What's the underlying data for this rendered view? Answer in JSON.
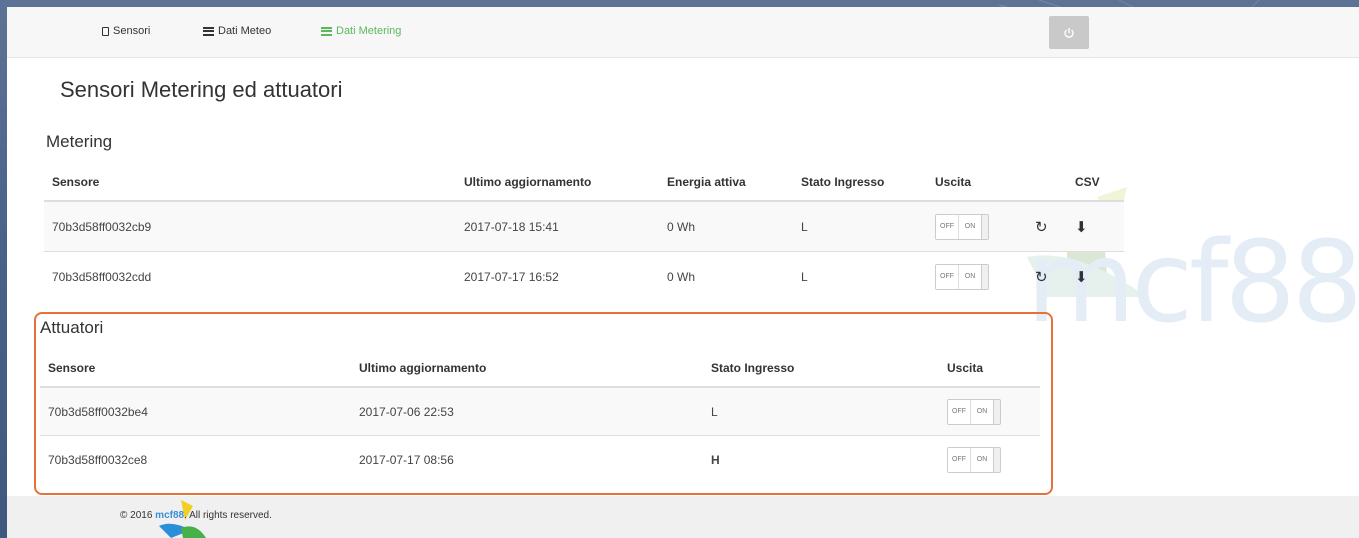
{
  "nav": {
    "items": [
      {
        "label": "Sensori",
        "icon": "mobile-icon"
      },
      {
        "label": "Dati Meteo",
        "icon": "list-icon"
      },
      {
        "label": "Dati Metering",
        "icon": "list-icon",
        "active": true
      }
    ],
    "power_icon": "power-icon",
    "active_color": "#5cb85c"
  },
  "page_title": "Sensori Metering ed attuatori",
  "metering": {
    "title": "Metering",
    "headers": [
      "Sensore",
      "Ultimo aggiornamento",
      "Energia attiva",
      "Stato Ingresso",
      "Uscita",
      "CSV"
    ],
    "rows": [
      {
        "sensore": "70b3d58ff0032cb9",
        "ultimo": "2017-07-18 15:41",
        "energia": "0 Wh",
        "stato": "L",
        "off": "OFF",
        "on": "ON"
      },
      {
        "sensore": "70b3d58ff0032cdd",
        "ultimo": "2017-07-17 16:52",
        "energia": "0 Wh",
        "stato": "L",
        "off": "OFF",
        "on": "ON"
      }
    ],
    "action_icons": [
      "refresh-icon",
      "download-icon"
    ]
  },
  "attuatori": {
    "title": "Attuatori",
    "headers": [
      "Sensore",
      "Ultimo aggiornamento",
      "Stato Ingresso",
      "Uscita"
    ],
    "rows": [
      {
        "sensore": "70b3d58ff0032be4",
        "ultimo": "2017-07-06 22:53",
        "stato": "L",
        "off": "OFF",
        "on": "ON"
      },
      {
        "sensore": "70b3d58ff0032ce8",
        "ultimo": "2017-07-17 08:56",
        "stato": "H",
        "off": "OFF",
        "on": "ON"
      }
    ],
    "highlight_color": "#e8703a"
  },
  "watermark": {
    "text": "mcf88"
  },
  "footer": {
    "prefix": "© 2016 ",
    "brand": "mcf88",
    "suffix": ". All rights reserved."
  }
}
